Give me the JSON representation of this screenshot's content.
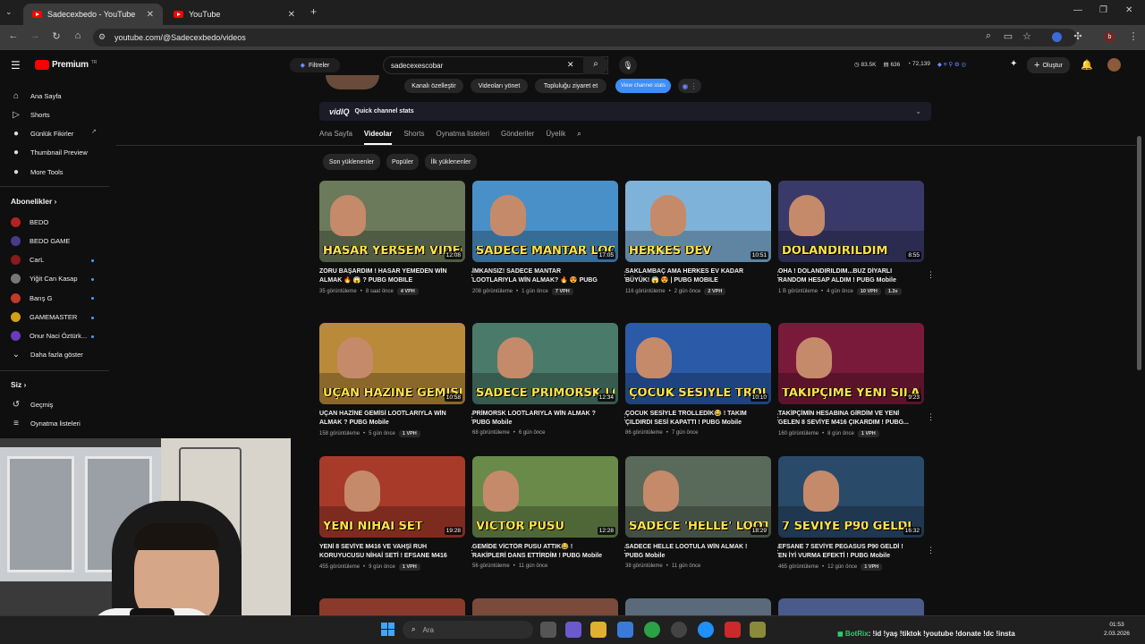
{
  "browser": {
    "tabs": [
      {
        "label": "Sadecexbedo - YouTube"
      },
      {
        "label": "YouTube"
      }
    ],
    "url": "youtube.com/@Sadecexbedo/videos"
  },
  "header": {
    "logo": "Premium",
    "logo_sup": "TR",
    "filters_label": "Filtreler",
    "search_value": "sadecexescobar",
    "stats": {
      "views": "83.5K",
      "videos": "636",
      "subs": "72,139"
    },
    "create_label": "Oluştur"
  },
  "channel_buttons": [
    "Kanalı özelleştir",
    "Videoları yönet",
    "Topluluğu ziyaret et",
    "View channel stats"
  ],
  "vidiq": {
    "logo": "vidIQ",
    "label": "Quick channel stats"
  },
  "channel_tabs": [
    "Ana Sayfa",
    "Videolar",
    "Shorts",
    "Oynatma listeleri",
    "Gönderiler",
    "Üyelik"
  ],
  "sort_chips": [
    "Son yüklenenler",
    "Popüler",
    "İlk yüklenenler"
  ],
  "sidebar": {
    "main": [
      {
        "label": "Ana Sayfa",
        "icon": "home-icon"
      },
      {
        "label": "Shorts",
        "icon": "shorts-icon"
      },
      {
        "label": "Günlük Fikirler",
        "icon": "bulb-icon"
      },
      {
        "label": "Thumbnail Preview",
        "icon": "thumbnail-icon"
      },
      {
        "label": "More Tools",
        "icon": "tools-icon"
      }
    ],
    "subs_header": "Abonelikler",
    "subs": [
      {
        "label": "BEDO",
        "color": "#b22222"
      },
      {
        "label": "BEDO GAME",
        "color": "#4b3a8c"
      },
      {
        "label": "CarL",
        "color": "#8b1a1a"
      },
      {
        "label": "Yiğit Can Kasap",
        "color": "#777777"
      },
      {
        "label": "Barış G",
        "color": "#c0392b"
      },
      {
        "label": "GAMEMASTER",
        "color": "#d4a017"
      },
      {
        "label": "Onur Naci Öztürk...",
        "color": "#6a3bbd"
      }
    ],
    "more_label": "Daha fazla göster",
    "you_header": "Siz",
    "you": [
      {
        "label": "Geçmiş",
        "icon": "history-icon"
      },
      {
        "label": "Oynatma listeleri",
        "icon": "playlist-icon"
      }
    ]
  },
  "videos": [
    {
      "caption": "HASAR YERSEM VİDEO BİTER",
      "duration": "12:08",
      "title": "ZORU BAŞARDIM ! HASAR YEMEDEN WİN ALMAK 🔥 😱 ? PUBG MOBILE",
      "views": "35 görüntüleme",
      "age": "8 saat önce",
      "badges": [
        "4 VPH"
      ],
      "bg": "#6a7a5a"
    },
    {
      "caption": "SADECE MANTAR LOOTLARIYLA WİN ALM...",
      "duration": "17:05",
      "title": "İMKANSIZ! SADECE MANTAR LOOTLARIYLA WİN ALMAK? 🔥 😍 PUBG MOBILE",
      "views": "208 görüntüleme",
      "age": "1 gün önce",
      "badges": [
        "7 VPH"
      ],
      "bg": "#4a90c8"
    },
    {
      "caption": "HERKES DEV",
      "duration": "10:51",
      "title": "SAKLAMBAÇ AMA HERKES EV KADAR BÜYÜK! 😱 😍 | PUBG MOBILE",
      "views": "116 görüntüleme",
      "age": "2 gün önce",
      "badges": [
        "2 VPH"
      ],
      "bg": "#7fb2d8"
    },
    {
      "caption": "DOLANDIRILDIM",
      "duration": "8:55",
      "title": "OHA ! DOLANDIRILDIM...BUZ DİYARLI RANDOM HESAP ALDIM ! PUBG Mobile",
      "views": "1 B görüntüleme",
      "age": "4 gün önce",
      "badges": [
        "10 VPH",
        "1.3x"
      ],
      "bg": "#3a3a6a"
    },
    {
      "caption": "UÇAN HAZİNE GEMİSİ LOOTLARIYLA WİN ALMAK",
      "duration": "10:58",
      "title": "UÇAN HAZİNE GEMİSİ LOOTLARIYLA WİN ALMAK ? PUBG Mobile",
      "views": "158 görüntüleme",
      "age": "5 gün önce",
      "badges": [
        "1 VPH"
      ],
      "bg": "#b88a3a"
    },
    {
      "caption": "SADECE PRİMORSK LOOTUYLA WİN ALMAK",
      "duration": "12:34",
      "title": "PRİMORSK LOOTLARIYLA WİN ALMAK ? PUBG Mobile",
      "views": "68 görüntüleme",
      "age": "6 gün önce",
      "badges": [],
      "bg": "#4a7a6a"
    },
    {
      "caption": "ÇOCUK SESİYLE TROLL",
      "duration": "10:10",
      "title": "ÇOCUK SESİYLE TROLLEDİK😂 ! TAKIM ÇILDIRDI SESİ KAPATTI ! PUBG Mobile",
      "views": "86 görüntüleme",
      "age": "7 gün önce",
      "badges": [],
      "bg": "#2a5aa8"
    },
    {
      "caption": "TAKİPÇİME YENİ SİLAHI ÇIKARDIM",
      "duration": "9:23",
      "title": "TAKİPÇİMİN HESABINA GİRDİM VE YENİ GELEN 8 SEVİYE M416 ÇIKARDIM ! PUBG...",
      "views": "160 görüntüleme",
      "age": "8 gün önce",
      "badges": [
        "1 VPH"
      ],
      "bg": "#7a1a3a"
    },
    {
      "caption": "YENİ NİHAİ SET",
      "duration": "19:28",
      "title": "YENİ 8 SEVİYE M416 VE VAHŞİ RUH KORUYUCUSU NİHAİ SETİ ! EFSANE M416 ...",
      "views": "455 görüntüleme",
      "age": "9 gün önce",
      "badges": [
        "1 VPH"
      ],
      "bg": "#a83a2a"
    },
    {
      "caption": "VİCTÖR PUSU",
      "duration": "12:28",
      "title": "GEMİDE VİCTÖR PUSU ATTIK😂 ! RAKİPLERİ DANS ETTİRDİM ! PUBG Mobile",
      "views": "56 görüntüleme",
      "age": "11 gün önce",
      "badges": [],
      "bg": "#6a8a4a"
    },
    {
      "caption": "SADECE 'HELLE' LOOT",
      "duration": "18:29",
      "title": "SADECE HELLE LOOTULA WİN ALMAK ! PUBG Mobile",
      "views": "38 görüntüleme",
      "age": "11 gün önce",
      "badges": [],
      "bg": "#5a6a5a"
    },
    {
      "caption": "7 SEVİYE P90 GELDİ",
      "duration": "16:32",
      "title": "EFSANE 7 SEVİYE PEGASUS P90 GELDİ ! EN İYİ VURMA EFEKTİ ! PUBG Mobile",
      "views": "465 görüntüleme",
      "age": "12 gün önce",
      "badges": [
        "1 VPH"
      ],
      "bg": "#2a4a6a"
    }
  ],
  "taskbar": {
    "search_placeholder": "Ara",
    "chat_user": "BotRix",
    "chat_msg": ": !id !yaş !tiktok !youtube !donate !dc !insta",
    "time": "01:53",
    "date": "2.03.2026"
  },
  "colors": {
    "accent": "#3ea6ff",
    "brand": "#ff0000",
    "vidiq_btn": "#3e8ef7"
  }
}
